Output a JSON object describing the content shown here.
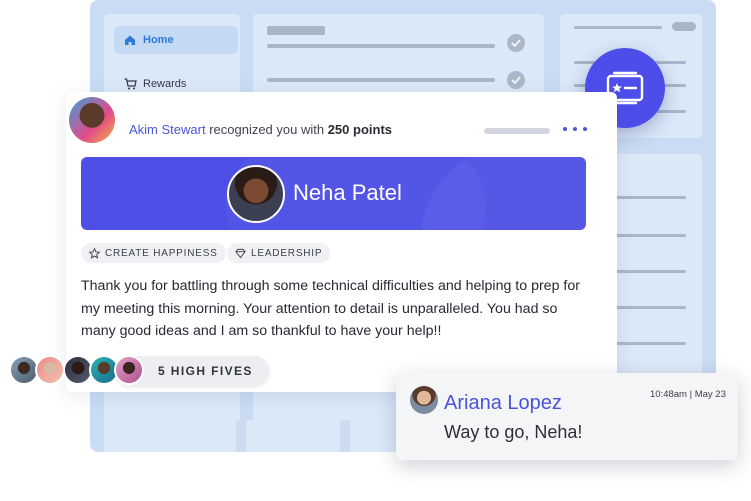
{
  "sidebar": {
    "items": [
      {
        "label": "Home",
        "icon": "home-icon",
        "active": true
      },
      {
        "label": "Rewards",
        "icon": "cart-icon",
        "active": false
      }
    ]
  },
  "post": {
    "author": "Akim Stewart",
    "action_text": " recognized you with ",
    "points": "250 points",
    "recipient": "Neha Patel",
    "tags": [
      {
        "label": "CREATE HAPPINESS",
        "icon": "star-icon"
      },
      {
        "label": "LEADERSHIP",
        "icon": "diamond-icon"
      }
    ],
    "message": "Thank you for battling through some technical difficulties and helping to prep for my meeting this morning. Your attention to detail is unparalleled. You had so many good ideas and I am so thankful to have your help!!",
    "high_fives": "5 HIGH FIVES"
  },
  "comment": {
    "author": "Ariana Lopez",
    "timestamp": "10:48am | May 23",
    "text": "Way to go, Neha!"
  },
  "colors": {
    "accent": "#4d4fe6",
    "link": "#4a53dd",
    "background_window": "#c9dcf3"
  }
}
